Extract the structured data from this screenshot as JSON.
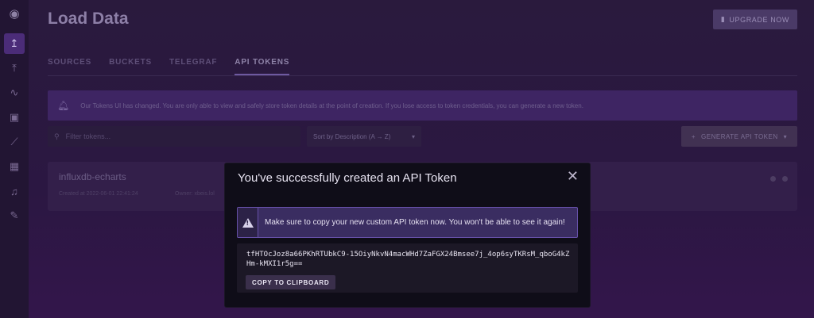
{
  "page": {
    "title": "Load Data",
    "upgrade_label": "UPGRADE NOW"
  },
  "sidebar": {
    "items": [
      {
        "icon": "logo-icon"
      },
      {
        "icon": "upload-icon",
        "active": true
      },
      {
        "icon": "data-explorer-icon"
      },
      {
        "icon": "notebook-icon"
      },
      {
        "icon": "dashboard-icon"
      },
      {
        "icon": "tasks-icon"
      },
      {
        "icon": "alerts-icon"
      },
      {
        "icon": "settings-icon"
      }
    ]
  },
  "tabs": [
    {
      "label": "SOURCES"
    },
    {
      "label": "BUCKETS"
    },
    {
      "label": "TELEGRAF"
    },
    {
      "label": "API TOKENS",
      "active": true
    }
  ],
  "info_banner": {
    "text": "Our Tokens UI has changed. You are only able to view and safely store token details at the point of creation. If you lose access to token credentials, you can generate a new token."
  },
  "filter": {
    "placeholder": "Filter tokens..."
  },
  "sort": {
    "selected": "Sort by Description (A → Z)"
  },
  "generate_button": {
    "label": "GENERATE API TOKEN"
  },
  "token_card": {
    "name": "influxdb-echarts",
    "created": "Created at 2022-06-01 22:41:24",
    "owner": "Owner: xbeis.lol"
  },
  "modal": {
    "title": "You've successfully created an API Token",
    "warning": "Make sure to copy your new custom API token now. You won't be able to see it again!",
    "token": "tfHTOcJoz8a66PKhRTUbkC9-15OiyNkvN4macWHd7ZaFGX24Bmsee7j_4op6syTKRsM_qboG4kZHm-kMXI1r5g==",
    "copy_label": "COPY TO CLIPBOARD"
  },
  "colors": {
    "accent": "#6650a8",
    "modal_bg": "#0f0d18",
    "warning_bg": "#3a2d61"
  }
}
